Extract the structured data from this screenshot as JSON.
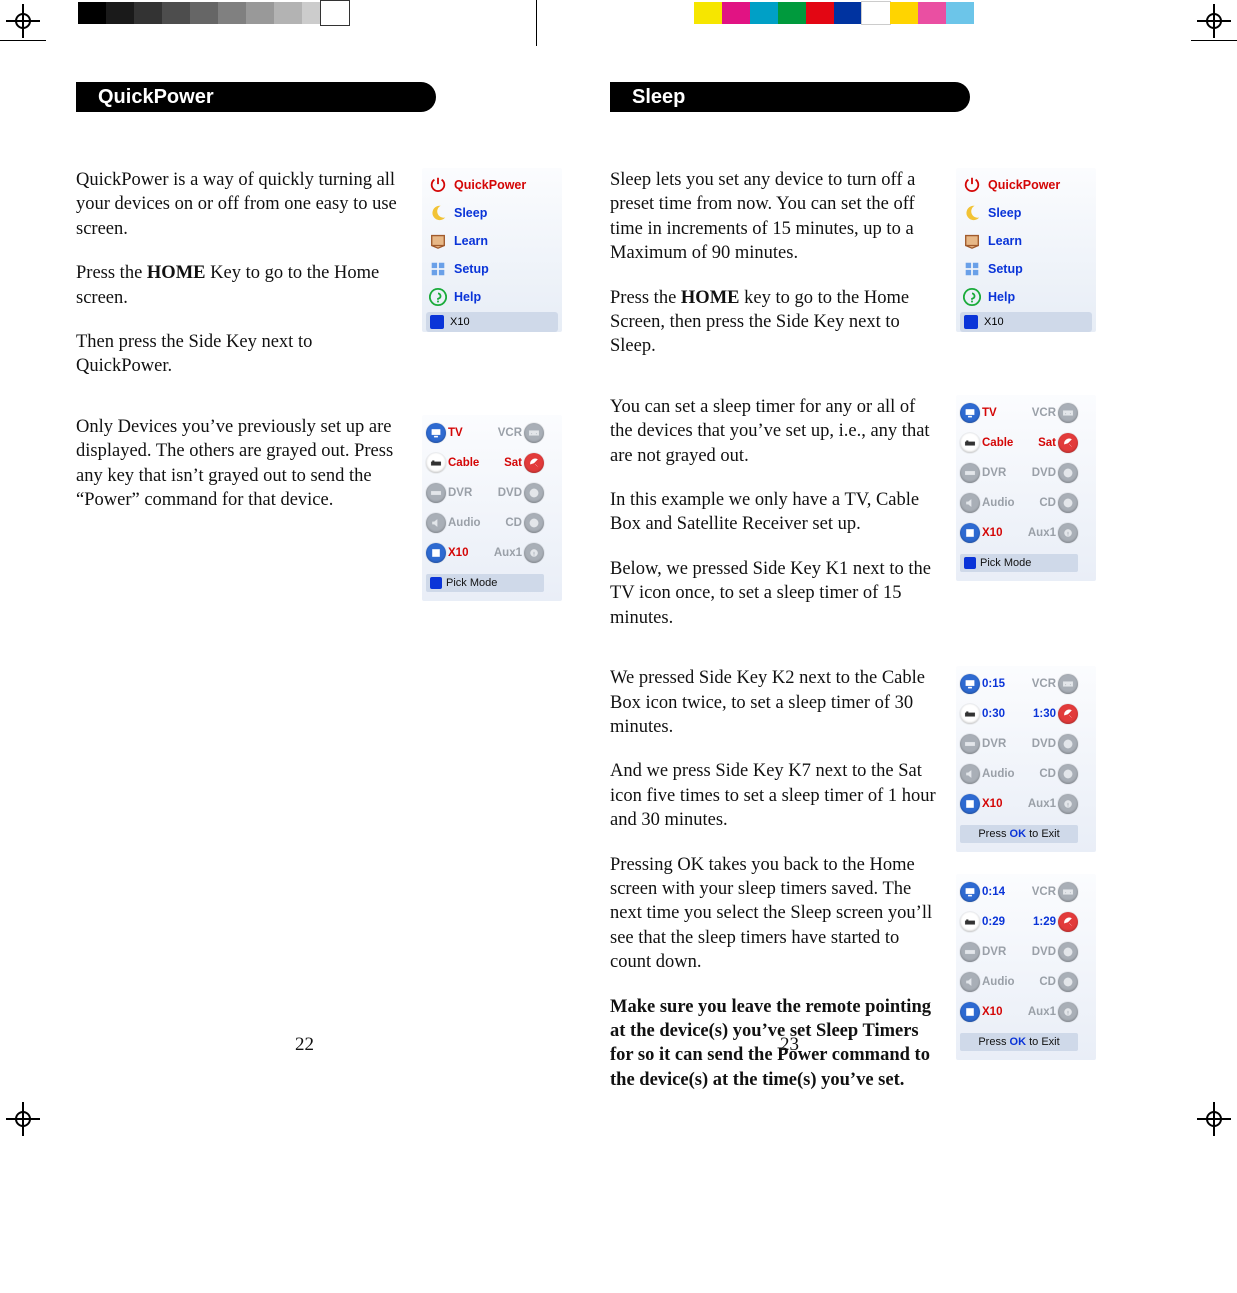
{
  "calibration": {
    "left_swatches": [
      "#000000",
      "#1a1a1a",
      "#333333",
      "#4d4d4d",
      "#666666",
      "#808080",
      "#999999",
      "#b3b3b3",
      "#cccccc"
    ],
    "right_swatches": [
      "#f6e600",
      "#e11383",
      "#00a0c6",
      "#009a3d",
      "#e30613",
      "#0033a0",
      "#ffffff",
      "#ffd400",
      "#ea4fa2",
      "#6cc5e9"
    ]
  },
  "left_page": {
    "number": "22",
    "heading": "QuickPower",
    "blocks": [
      {
        "paras": [
          {
            "t": "QuickPower is a way of quickly turning all your devices on or off from one easy to use screen."
          },
          {
            "t": "Press the {b}HOME{/b} Key to go to the Home screen."
          },
          {
            "t": "Then press the Side Key next to QuickPower."
          }
        ],
        "shot": {
          "type": "home_menu",
          "highlight": "QuickPower"
        }
      },
      {
        "paras": [
          {
            "t": "Only Devices you’ve previously set up are displayed. The others are grayed out. Press any key that isn’t grayed out to send the “Power” command for that device."
          }
        ],
        "shot": {
          "type": "device_grid",
          "footer": "Pick Mode",
          "footer_icon": true,
          "cells": [
            [
              "tv",
              "TV",
              "on",
              "VCR",
              "vcr",
              "off"
            ],
            [
              "cable",
              "Cable",
              "on",
              "Sat",
              "sat",
              "on"
            ],
            [
              "dvr",
              "DVR",
              "off",
              "DVD",
              "dvd",
              "off"
            ],
            [
              "audio",
              "Audio",
              "off",
              "CD",
              "cd",
              "off"
            ],
            [
              "x10",
              "X10",
              "on",
              "Aux1",
              "aux",
              "off"
            ]
          ]
        }
      }
    ]
  },
  "right_page": {
    "number": "23",
    "heading": "Sleep",
    "blocks": [
      {
        "paras": [
          {
            "t": "Sleep lets you set any device to turn off a preset time from now. You can set the off time in increments of 15 minutes, up to a Maximum of 90 minutes."
          },
          {
            "t": "Press the {b}HOME{/b} key to go to the Home Screen, then press the Side Key next to Sleep."
          }
        ],
        "shot": {
          "type": "home_menu",
          "highlight": "Sleep"
        }
      },
      {
        "paras": [
          {
            "t": "You can set a sleep timer for any or all of the devices that you’ve set up, i.e., any that are not grayed out."
          },
          {
            "t": "In this example we only have a TV, Cable Box and Satellite Receiver set up."
          },
          {
            "t": "Below, we pressed Side Key K1 next to the TV icon once, to set a sleep timer of 15 minutes."
          }
        ],
        "shot": {
          "type": "device_grid",
          "footer": "Pick Mode",
          "footer_icon": true,
          "cells": [
            [
              "tv",
              "TV",
              "on",
              "VCR",
              "vcr",
              "off"
            ],
            [
              "cable",
              "Cable",
              "on",
              "Sat",
              "sat",
              "on"
            ],
            [
              "dvr",
              "DVR",
              "off",
              "DVD",
              "dvd",
              "off"
            ],
            [
              "audio",
              "Audio",
              "off",
              "CD",
              "cd",
              "off"
            ],
            [
              "x10",
              "X10",
              "on",
              "Aux1",
              "aux",
              "off"
            ]
          ]
        }
      },
      {
        "paras": [
          {
            "t": "We pressed Side Key K2 next to the Cable Box icon twice, to set a sleep timer of 30 minutes."
          },
          {
            "t": "And we press Side Key K7 next to the Sat icon five times to set a sleep timer of 1 hour and 30 minutes."
          },
          {
            "t": "Pressing OK takes you back to the Home screen with your sleep timers saved. The next time you select the Sleep screen you’ll see that the sleep timers have started to count down."
          },
          {
            "t": "{b}Make sure you leave the remote pointing at the device(s) you’ve set Sleep Timers for so it can send the Power command to the device(s) at the time(s) you’ve set.{/b}"
          }
        ],
        "shot_stack": [
          {
            "type": "device_grid",
            "footer": "Press OK to Exit",
            "footer_ok": true,
            "cells": [
              [
                "tv",
                "0:15",
                "blue",
                "VCR",
                "vcr",
                "off"
              ],
              [
                "cable",
                "0:30",
                "blue",
                "1:30",
                "sat",
                "blue"
              ],
              [
                "dvr",
                "DVR",
                "off",
                "DVD",
                "dvd",
                "off"
              ],
              [
                "audio",
                "Audio",
                "off",
                "CD",
                "cd",
                "off"
              ],
              [
                "x10",
                "X10",
                "on",
                "Aux1",
                "aux",
                "off"
              ]
            ]
          },
          {
            "type": "device_grid",
            "footer": "Press OK to Exit",
            "footer_ok": true,
            "cells": [
              [
                "tv",
                "0:14",
                "blue",
                "VCR",
                "vcr",
                "off"
              ],
              [
                "cable",
                "0:29",
                "blue",
                "1:29",
                "sat",
                "blue"
              ],
              [
                "dvr",
                "DVR",
                "off",
                "DVD",
                "dvd",
                "off"
              ],
              [
                "audio",
                "Audio",
                "off",
                "CD",
                "cd",
                "off"
              ],
              [
                "x10",
                "X10",
                "on",
                "Aux1",
                "aux",
                "off"
              ]
            ]
          }
        ]
      }
    ]
  },
  "home_menu": {
    "items": [
      {
        "icon": "power-icon",
        "label": "QuickPower",
        "color": "red"
      },
      {
        "icon": "moon-icon",
        "label": "Sleep",
        "color": "blue"
      },
      {
        "icon": "learn-icon",
        "label": "Learn",
        "color": "blue"
      },
      {
        "icon": "setup-icon",
        "label": "Setup",
        "color": "blue"
      },
      {
        "icon": "help-icon",
        "label": "Help",
        "color": "blue"
      }
    ],
    "footer": "X10"
  },
  "device_icons": {
    "tv": {
      "bg": "#2e6ad1",
      "glyph": "tv"
    },
    "vcr": {
      "bg": "#8b949e",
      "glyph": "tape"
    },
    "cable": {
      "bg": "#ffffff",
      "glyph": "cable"
    },
    "sat": {
      "bg": "#e23b3b",
      "glyph": "sat"
    },
    "dvr": {
      "bg": "#8b949e",
      "glyph": "dvr"
    },
    "dvd": {
      "bg": "#8b949e",
      "glyph": "disc"
    },
    "audio": {
      "bg": "#8b949e",
      "glyph": "spk"
    },
    "cd": {
      "bg": "#8b949e",
      "glyph": "disc"
    },
    "x10": {
      "bg": "#2e6ad1",
      "glyph": "x10"
    },
    "aux": {
      "bg": "#d9c84a",
      "glyph": "q"
    }
  }
}
